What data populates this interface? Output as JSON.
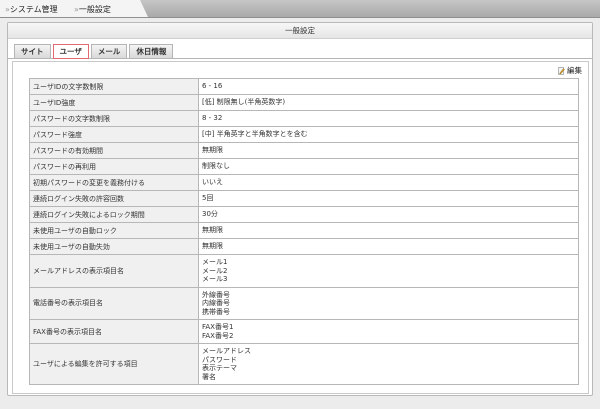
{
  "breadcrumb": [
    {
      "label": "システム管理"
    },
    {
      "label": "一般設定"
    }
  ],
  "panel_title": "一般設定",
  "tabs": [
    {
      "label": "サイト"
    },
    {
      "label": "ユーザ"
    },
    {
      "label": "メール"
    },
    {
      "label": "休日情報"
    }
  ],
  "edit_label": "編集",
  "rows": [
    {
      "label": "ユーザIDの文字数制限",
      "values": [
        "6 - 16"
      ]
    },
    {
      "label": "ユーザID強度",
      "values": [
        "[低] 制限無し(半角英数字)"
      ]
    },
    {
      "label": "パスワードの文字数制限",
      "values": [
        "8 - 32"
      ]
    },
    {
      "label": "パスワード強度",
      "values": [
        "[中] 半角英字と半角数字とを含む"
      ]
    },
    {
      "label": "パスワードの有効期間",
      "values": [
        "無期限"
      ]
    },
    {
      "label": "パスワードの再利用",
      "values": [
        "制限なし"
      ]
    },
    {
      "label": "初期パスワードの変更を義務付ける",
      "values": [
        "いいえ"
      ]
    },
    {
      "label": "連続ログイン失敗の許容回数",
      "values": [
        "5回"
      ]
    },
    {
      "label": "連続ログイン失敗によるロック期間",
      "values": [
        "30分"
      ]
    },
    {
      "label": "未使用ユーザの自動ロック",
      "values": [
        "無期限"
      ]
    },
    {
      "label": "未使用ユーザの自動失効",
      "values": [
        "無期限"
      ]
    },
    {
      "label": "メールアドレスの表示項目名",
      "values": [
        "メール1",
        "メール2",
        "メール3"
      ]
    },
    {
      "label": "電話番号の表示項目名",
      "values": [
        "外線番号",
        "内線番号",
        "携帯番号"
      ]
    },
    {
      "label": "FAX番号の表示項目名",
      "values": [
        "FAX番号1",
        "FAX番号2"
      ]
    },
    {
      "label": "ユーザによる編集を許可する項目",
      "values": [
        "メールアドレス",
        "パスワード",
        "表示テーマ",
        "署名"
      ]
    }
  ]
}
